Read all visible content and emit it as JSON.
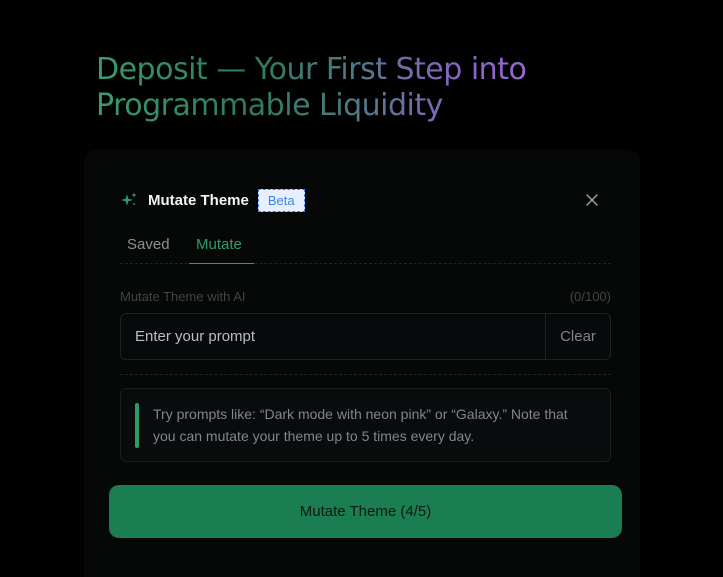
{
  "hero": {
    "title": "Deposit — Your First Step into Programmable Liquidity",
    "subtitle": ""
  },
  "dialog": {
    "title": "Mutate Theme",
    "badge": "Beta",
    "tabs": [
      {
        "label": "Saved",
        "active": false
      },
      {
        "label": "Mutate",
        "active": true
      }
    ],
    "field_label": "Mutate Theme with AI",
    "counter": "(0/100)",
    "input": {
      "value": "",
      "placeholder": "Enter your prompt"
    },
    "clear_label": "Clear",
    "hint": "Try prompts like: “Dark mode with neon pink” or “Galaxy.” Note that you can mutate your theme up to 5 times every day.",
    "submit_label": "Mutate Theme (4/5)",
    "icons": {
      "header": "sparkle-icon",
      "close": "close-icon"
    },
    "colors": {
      "accent": "#2e9c6d",
      "button": "#1b7d52",
      "badge": "#3b82f6"
    }
  }
}
